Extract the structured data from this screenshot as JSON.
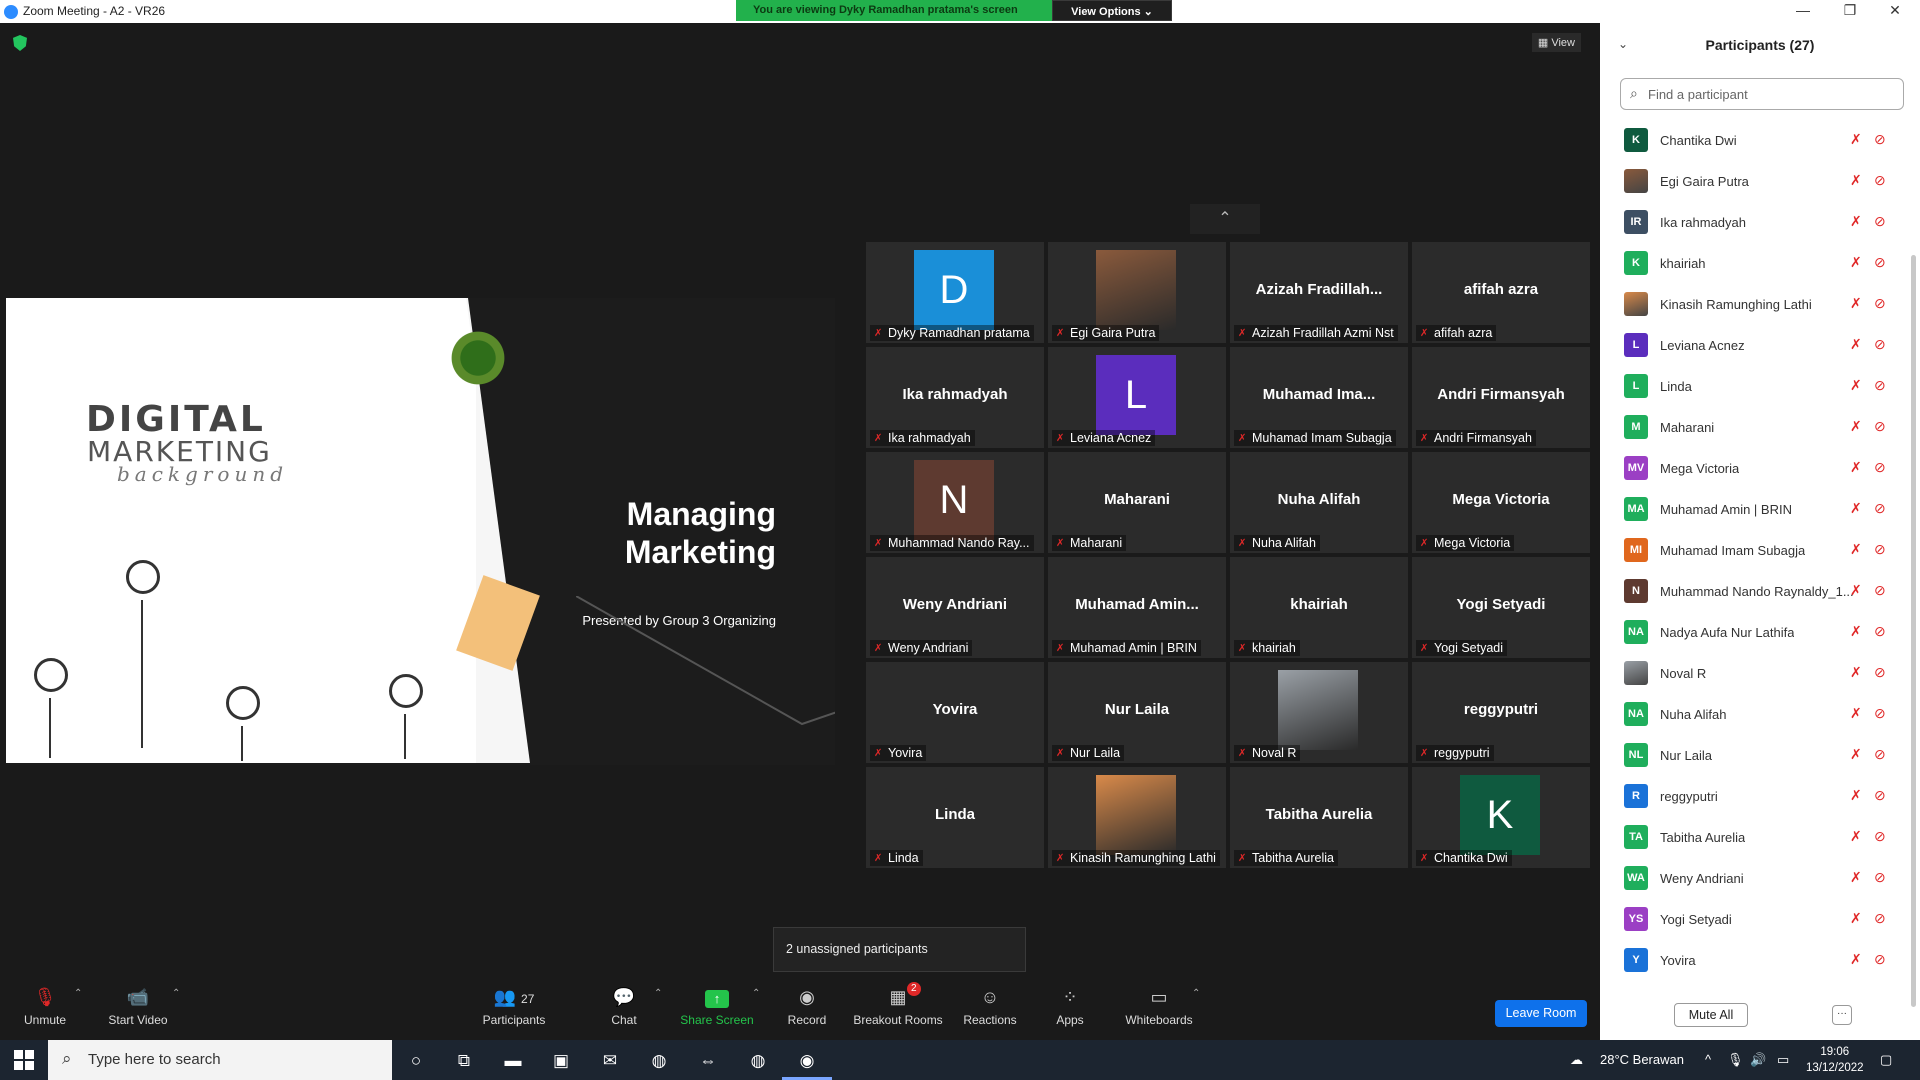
{
  "window": {
    "title": "Zoom Meeting - A2 - VR26",
    "minimize": "—",
    "maximize": "❐",
    "close": "✕"
  },
  "share_banner": {
    "text": "You are viewing Dyky Ramadhan pratama's screen",
    "view_options": "View Options ⌄"
  },
  "stage": {
    "view_label": "View",
    "show_more": "⌃"
  },
  "slide": {
    "brand_line1": "DIGITAL",
    "brand_line2": "MARKETING",
    "brand_line3": "background",
    "title": "Managing Marketing",
    "subtitle": "Presented by Group 3 Organizing"
  },
  "tiles": [
    {
      "label": "Dyky Ramadhan pratama",
      "avatar": "D",
      "color": "#1a8fd8"
    },
    {
      "label": "Egi Gaira Putra",
      "photo": true,
      "color": "#8a5a3c"
    },
    {
      "label": "Azizah Fradillah Azmi Nst",
      "name": "Azizah  Fradillah..."
    },
    {
      "label": "afifah azra",
      "name": "afifah azra"
    },
    {
      "label": "Ika rahmadyah",
      "name": "Ika rahmadyah"
    },
    {
      "label": "Leviana Acnez",
      "avatar": "L",
      "color": "#5b2dbd"
    },
    {
      "label": "Muhamad Imam Subagja",
      "name": "Muhamad  Ima..."
    },
    {
      "label": "Andri Firmansyah",
      "name": "Andri Firmansyah"
    },
    {
      "label": "Muhammad Nando Ray...",
      "avatar": "N",
      "color": "#5e3a30"
    },
    {
      "label": "Maharani",
      "name": "Maharani"
    },
    {
      "label": "Nuha Alifah",
      "name": "Nuha Alifah"
    },
    {
      "label": "Mega Victoria",
      "name": "Mega Victoria"
    },
    {
      "label": "Weny Andriani",
      "name": "Weny Andriani"
    },
    {
      "label": "Muhamad Amin | BRIN",
      "name": "Muhamad  Amin..."
    },
    {
      "label": "khairiah",
      "name": "khairiah"
    },
    {
      "label": "Yogi Setyadi",
      "name": "Yogi Setyadi"
    },
    {
      "label": "Yovira",
      "name": "Yovira"
    },
    {
      "label": "Nur Laila",
      "name": "Nur Laila"
    },
    {
      "label": "Noval R",
      "photo": true,
      "color": "#9aa0a6"
    },
    {
      "label": "reggyputri",
      "name": "reggyputri"
    },
    {
      "label": "Linda",
      "name": "Linda"
    },
    {
      "label": "Kinasih Ramunghing Lathi",
      "photo": true,
      "color": "#d98a4a"
    },
    {
      "label": "Tabitha Aurelia",
      "name": "Tabitha Aurelia"
    },
    {
      "label": "Chantika Dwi",
      "avatar": "K",
      "color": "#0f5a3f"
    }
  ],
  "tooltip": "2 unassigned participants",
  "toolbar": {
    "unmute": "Unmute",
    "start_video": "Start Video",
    "participants": "Participants",
    "participants_count": "27",
    "chat": "Chat",
    "share_screen": "Share Screen",
    "record": "Record",
    "breakout_rooms": "Breakout Rooms",
    "breakout_badge": "2",
    "reactions": "Reactions",
    "apps": "Apps",
    "whiteboards": "Whiteboards",
    "leave": "Leave Room"
  },
  "panel": {
    "title": "Participants (27)",
    "search_placeholder": "Find a participant",
    "mute_all": "Mute All",
    "more": "···",
    "participants": [
      {
        "initials": "K",
        "name": "Chantika Dwi",
        "color": "#0f5a3f"
      },
      {
        "initials": "",
        "name": "Egi Gaira Putra",
        "color": "#8a5a3c",
        "photo": true
      },
      {
        "initials": "IR",
        "name": "Ika rahmadyah",
        "color": "#3d4f63"
      },
      {
        "initials": "K",
        "name": "khairiah",
        "color": "#1fae5c"
      },
      {
        "initials": "",
        "name": "Kinasih Ramunghing Lathi",
        "color": "#d98a4a",
        "photo": true
      },
      {
        "initials": "L",
        "name": "Leviana Acnez",
        "color": "#5b2dbd"
      },
      {
        "initials": "L",
        "name": "Linda",
        "color": "#1fae5c"
      },
      {
        "initials": "M",
        "name": "Maharani",
        "color": "#1fae5c"
      },
      {
        "initials": "MV",
        "name": "Mega Victoria",
        "color": "#9b3fc4"
      },
      {
        "initials": "MA",
        "name": "Muhamad Amin | BRIN",
        "color": "#1fae5c"
      },
      {
        "initials": "MI",
        "name": "Muhamad Imam Subagja",
        "color": "#e0671d"
      },
      {
        "initials": "N",
        "name": "Muhammad Nando Raynaldy_1...",
        "color": "#5e3a30"
      },
      {
        "initials": "NA",
        "name": "Nadya Aufa Nur Lathifa",
        "color": "#1fae5c"
      },
      {
        "initials": "",
        "name": "Noval R",
        "color": "#9aa0a6",
        "photo": true
      },
      {
        "initials": "NA",
        "name": "Nuha Alifah",
        "color": "#1fae5c"
      },
      {
        "initials": "NL",
        "name": "Nur Laila",
        "color": "#1fae5c"
      },
      {
        "initials": "R",
        "name": "reggyputri",
        "color": "#1a72d8"
      },
      {
        "initials": "TA",
        "name": "Tabitha Aurelia",
        "color": "#1fae5c"
      },
      {
        "initials": "WA",
        "name": "Weny Andriani",
        "color": "#1fae5c"
      },
      {
        "initials": "YS",
        "name": "Yogi Setyadi",
        "color": "#9b3fc4"
      },
      {
        "initials": "Y",
        "name": "Yovira",
        "color": "#1a72d8"
      }
    ]
  },
  "taskbar": {
    "search_placeholder": "Type here to search",
    "weather": "28°C  Berawan",
    "time": "19:06",
    "date": "13/12/2022"
  }
}
